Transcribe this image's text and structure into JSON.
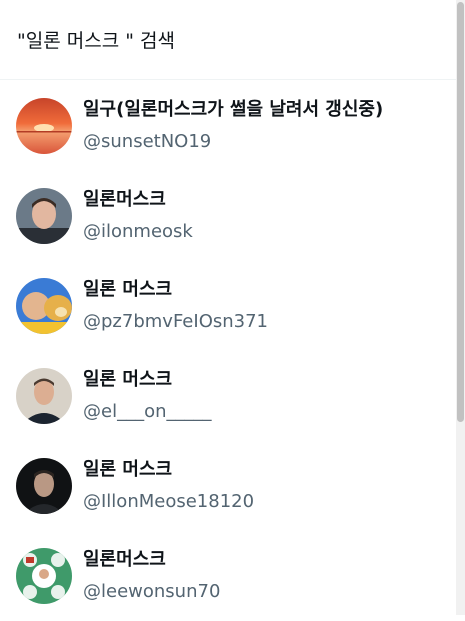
{
  "header": {
    "title": "\"일론 머스크 \" 검색"
  },
  "results": [
    {
      "name": "일구(일론머스크가 썰을 날려서 갱신중)",
      "handle": "@sunsetNO19",
      "avatar": "sunset-avatar"
    },
    {
      "name": "일론머스크",
      "handle": "@ilonmeosk",
      "avatar": "man-portrait-avatar"
    },
    {
      "name": "일론 머스크",
      "handle": "@pz7bmvFeIOsn371",
      "avatar": "doge-meme-avatar"
    },
    {
      "name": "일론 머스크",
      "handle": "@el___on_____",
      "avatar": "man-suit-avatar"
    },
    {
      "name": "일론 머스크",
      "handle": "@IllonMeose18120",
      "avatar": "man-dark-avatar"
    },
    {
      "name": "일론머스크",
      "handle": "@leewonsun70",
      "avatar": "collage-avatar"
    }
  ]
}
